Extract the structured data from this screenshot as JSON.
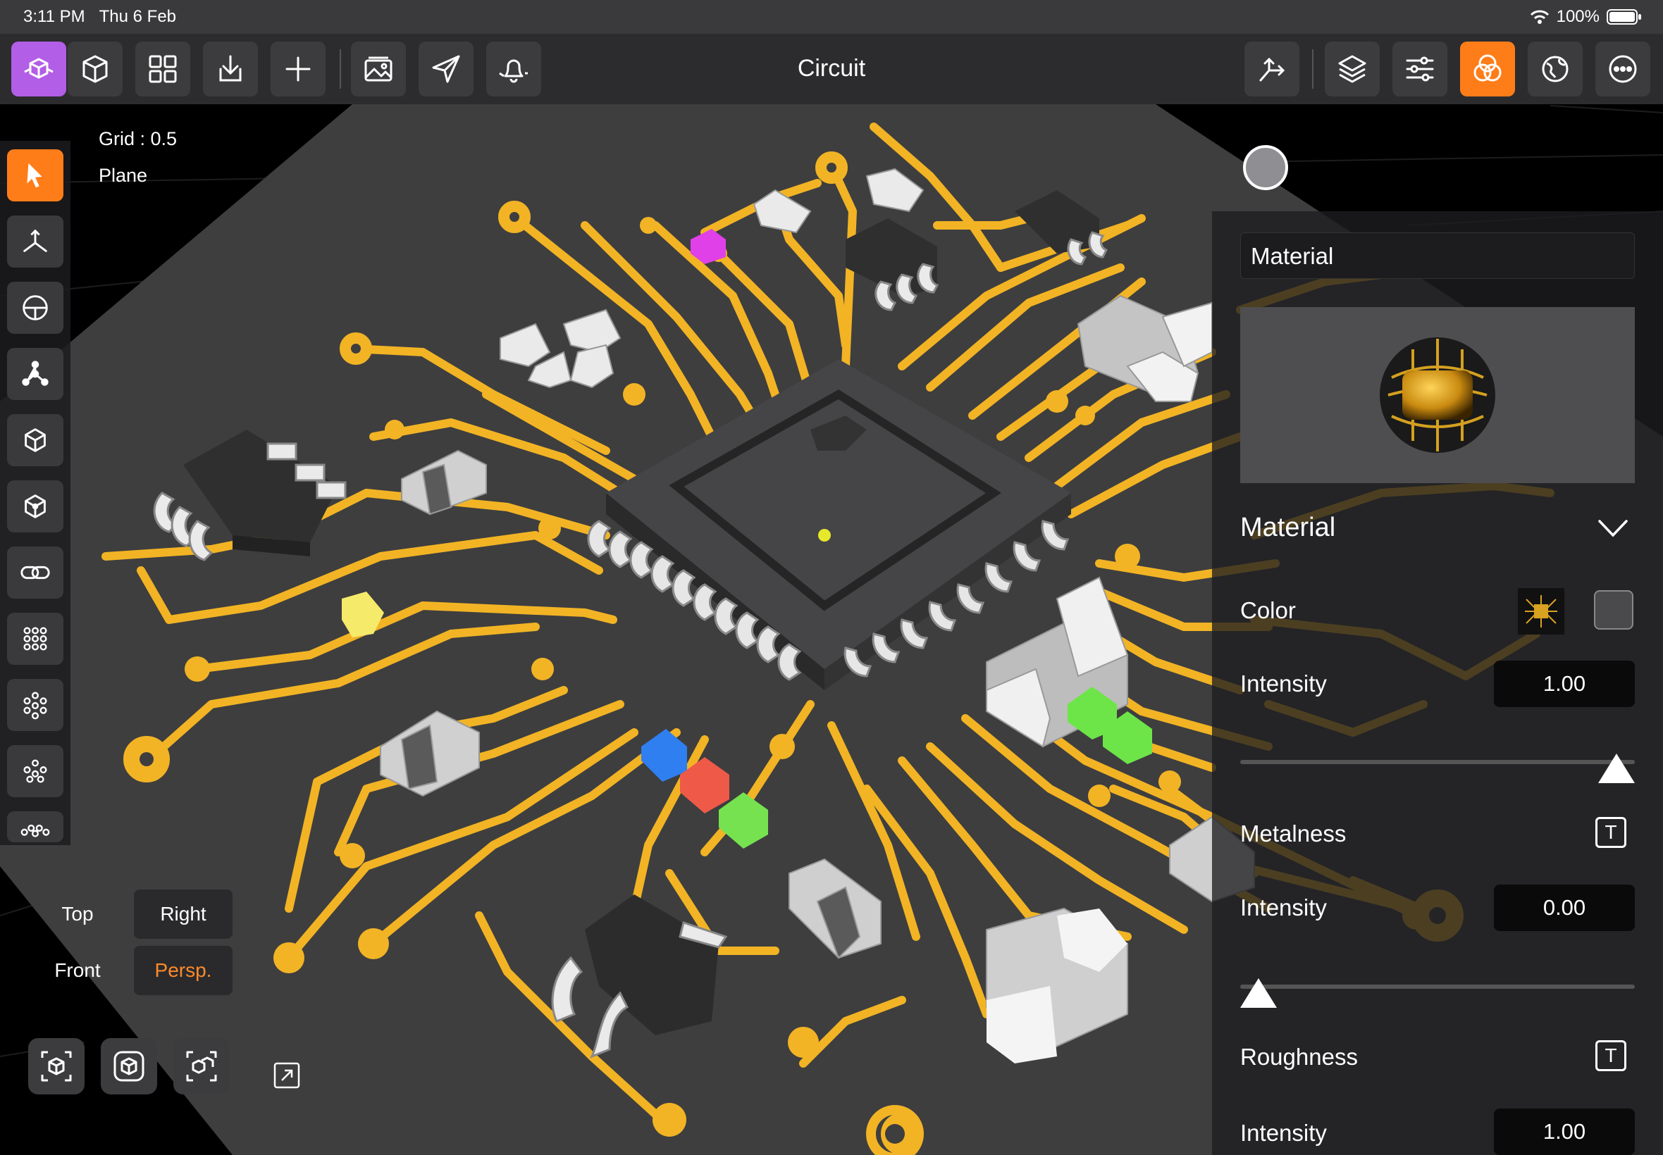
{
  "status": {
    "time": "3:11 PM",
    "date": "Thu 6 Feb",
    "battery": "100%"
  },
  "toolbar": {
    "title": "Circuit"
  },
  "info": {
    "grid": "Grid : 0.5",
    "plane": "Plane"
  },
  "views": {
    "top": "Top",
    "right": "Right",
    "front": "Front",
    "persp": "Persp."
  },
  "panel": {
    "material_input": "Material",
    "section_title": "Material",
    "color_label": "Color",
    "intensity_label_1": "Intensity",
    "intensity_value_1": "1.00",
    "intensity_level_1": 1.0,
    "metalness_label": "Metalness",
    "intensity_label_2": "Intensity",
    "intensity_value_2": "0.00",
    "intensity_level_2": 0.0,
    "roughness_label": "Roughness",
    "intensity_label_3": "Intensity",
    "intensity_value_3": "1.00",
    "texture_button": "T"
  },
  "colors": {
    "accent": "#ff7d19",
    "select": "#b35ee6",
    "trace": "#f2b424",
    "board": "#3e3e3f"
  }
}
